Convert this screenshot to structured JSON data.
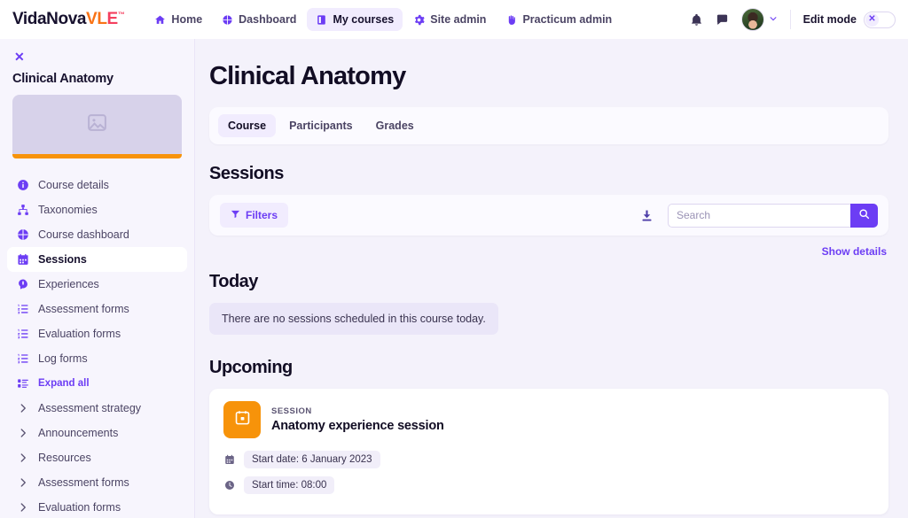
{
  "navbar": {
    "brand": {
      "part1": "VidaNova",
      "part2": "VL",
      "part3": "E",
      "tm": "™"
    },
    "links": [
      {
        "label": "Home",
        "icon": "home-icon",
        "active": false
      },
      {
        "label": "Dashboard",
        "icon": "dashboard-icon",
        "active": false
      },
      {
        "label": "My courses",
        "icon": "book-icon",
        "active": true
      },
      {
        "label": "Site admin",
        "icon": "gear-icon",
        "active": false
      },
      {
        "label": "Practicum admin",
        "icon": "hand-icon",
        "active": false
      }
    ],
    "notifications_icon": "bell-icon",
    "messages_icon": "chat-icon",
    "avatar_icon": "avatar",
    "avatar_chevron": "chevron-down-icon",
    "edit_mode_label": "Edit mode",
    "edit_mode_state": "off",
    "edit_mode_knob_glyph": "✕"
  },
  "sidebar": {
    "close_glyph": "✕",
    "course_name": "Clinical Anatomy",
    "thumb_icon": "image-placeholder-icon",
    "accent_color": "#f7930a",
    "items": [
      {
        "label": "Course details",
        "icon": "info-icon",
        "type": "link",
        "active": false
      },
      {
        "label": "Taxonomies",
        "icon": "sitemap-icon",
        "type": "link",
        "active": false
      },
      {
        "label": "Course dashboard",
        "icon": "dashboard-icon",
        "type": "link",
        "active": false
      },
      {
        "label": "Sessions",
        "icon": "calendar-icon",
        "type": "link",
        "active": true
      },
      {
        "label": "Experiences",
        "icon": "head-idea-icon",
        "type": "link",
        "active": false
      },
      {
        "label": "Assessment forms",
        "icon": "list-ol-icon",
        "type": "link",
        "active": false
      },
      {
        "label": "Evaluation forms",
        "icon": "list-ol-icon",
        "type": "link",
        "active": false
      },
      {
        "label": "Log forms",
        "icon": "list-ol-icon",
        "type": "link",
        "active": false
      },
      {
        "label": "Expand all",
        "icon": "expand-list-icon",
        "type": "accent-link",
        "active": false
      },
      {
        "label": "Assessment strategy",
        "icon": "chevron-right-icon",
        "type": "collapsible",
        "active": false
      },
      {
        "label": "Announcements",
        "icon": "chevron-right-icon",
        "type": "collapsible",
        "active": false
      },
      {
        "label": "Resources",
        "icon": "chevron-right-icon",
        "type": "collapsible",
        "active": false
      },
      {
        "label": "Assessment forms",
        "icon": "chevron-right-icon",
        "type": "collapsible",
        "active": false
      },
      {
        "label": "Evaluation forms",
        "icon": "chevron-right-icon",
        "type": "collapsible",
        "active": false
      }
    ]
  },
  "main": {
    "page_title": "Clinical Anatomy",
    "tabs": [
      {
        "label": "Course",
        "active": true
      },
      {
        "label": "Participants",
        "active": false
      },
      {
        "label": "Grades",
        "active": false
      }
    ],
    "sessions_heading": "Sessions",
    "toolbar": {
      "filters_label": "Filters",
      "filters_icon": "funnel-icon",
      "download_icon": "download-icon",
      "search_placeholder": "Search",
      "search_value": "",
      "search_button_icon": "search-icon"
    },
    "show_details_label": "Show details",
    "today": {
      "heading": "Today",
      "empty_message": "There are no sessions scheduled in this course today."
    },
    "upcoming": {
      "heading": "Upcoming",
      "sessions": [
        {
          "icon": "calendar-icon",
          "icon_color": "#f7930a",
          "kicker": "SESSION",
          "title": "Anatomy experience session",
          "meta": [
            {
              "icon": "calendar-icon",
              "text": "Start date: 6 January 2023"
            },
            {
              "icon": "clock-icon",
              "text": "Start time: 08:00"
            }
          ]
        }
      ]
    }
  },
  "colors": {
    "accent": "#6c3df4",
    "accent_soft": "#f1ecfe",
    "orange": "#f7930a",
    "page_bg": "#f4f2fb",
    "text": "#17112e"
  }
}
